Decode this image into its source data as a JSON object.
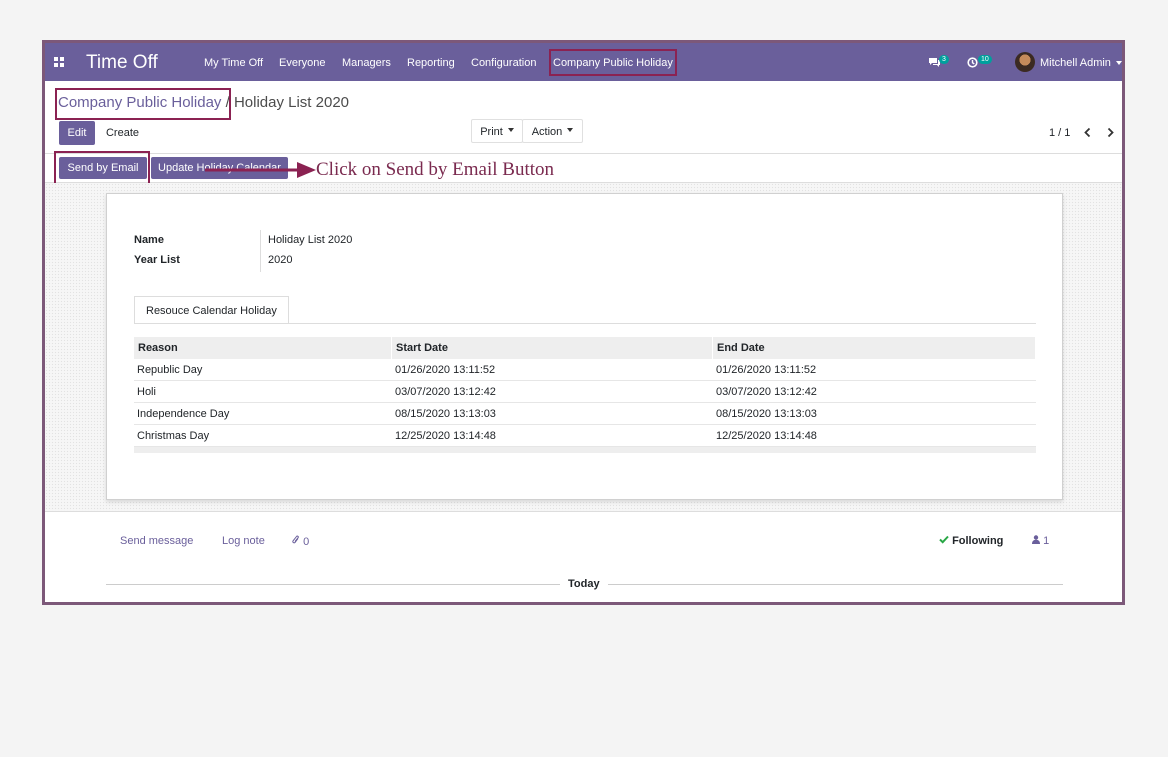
{
  "navbar": {
    "app_name": "Time Off",
    "menu": [
      "My Time Off",
      "Everyone",
      "Managers",
      "Reporting",
      "Configuration",
      "Company Public Holiday"
    ],
    "messages_count": "3",
    "activities_count": "10",
    "user_name": "Mitchell Admin"
  },
  "breadcrumb": {
    "parent": "Company Public Holiday",
    "separator": "/",
    "current": "Holiday List 2020"
  },
  "control_panel": {
    "edit_label": "Edit",
    "create_label": "Create",
    "print_label": "Print",
    "action_label": "Action",
    "pager": "1 / 1"
  },
  "statusbar": {
    "send_email_label": "Send by Email",
    "update_calendar_label": "Update Holiday Calendar"
  },
  "annotation": {
    "text": "Click on Send by Email Button"
  },
  "form": {
    "name_label": "Name",
    "name_value": "Holiday List 2020",
    "year_label": "Year List",
    "year_value": "2020",
    "tab_label": "Resouce Calendar Holiday",
    "table": {
      "headers": [
        "Reason",
        "Start Date",
        "End Date"
      ],
      "rows": [
        [
          "Republic Day",
          "01/26/2020 13:11:52",
          "01/26/2020 13:11:52"
        ],
        [
          "Holi",
          "03/07/2020 13:12:42",
          "03/07/2020 13:12:42"
        ],
        [
          "Independence Day",
          "08/15/2020 13:13:03",
          "08/15/2020 13:13:03"
        ],
        [
          "Christmas Day",
          "12/25/2020 13:14:48",
          "12/25/2020 13:14:48"
        ]
      ]
    }
  },
  "chatter": {
    "send_message": "Send message",
    "log_note": "Log note",
    "attachments_count": "0",
    "following": "Following",
    "followers_count": "1",
    "today": "Today"
  },
  "colors": {
    "brand": "#6a5f9b",
    "annotation": "#8b2252",
    "following_check": "#28a745"
  }
}
